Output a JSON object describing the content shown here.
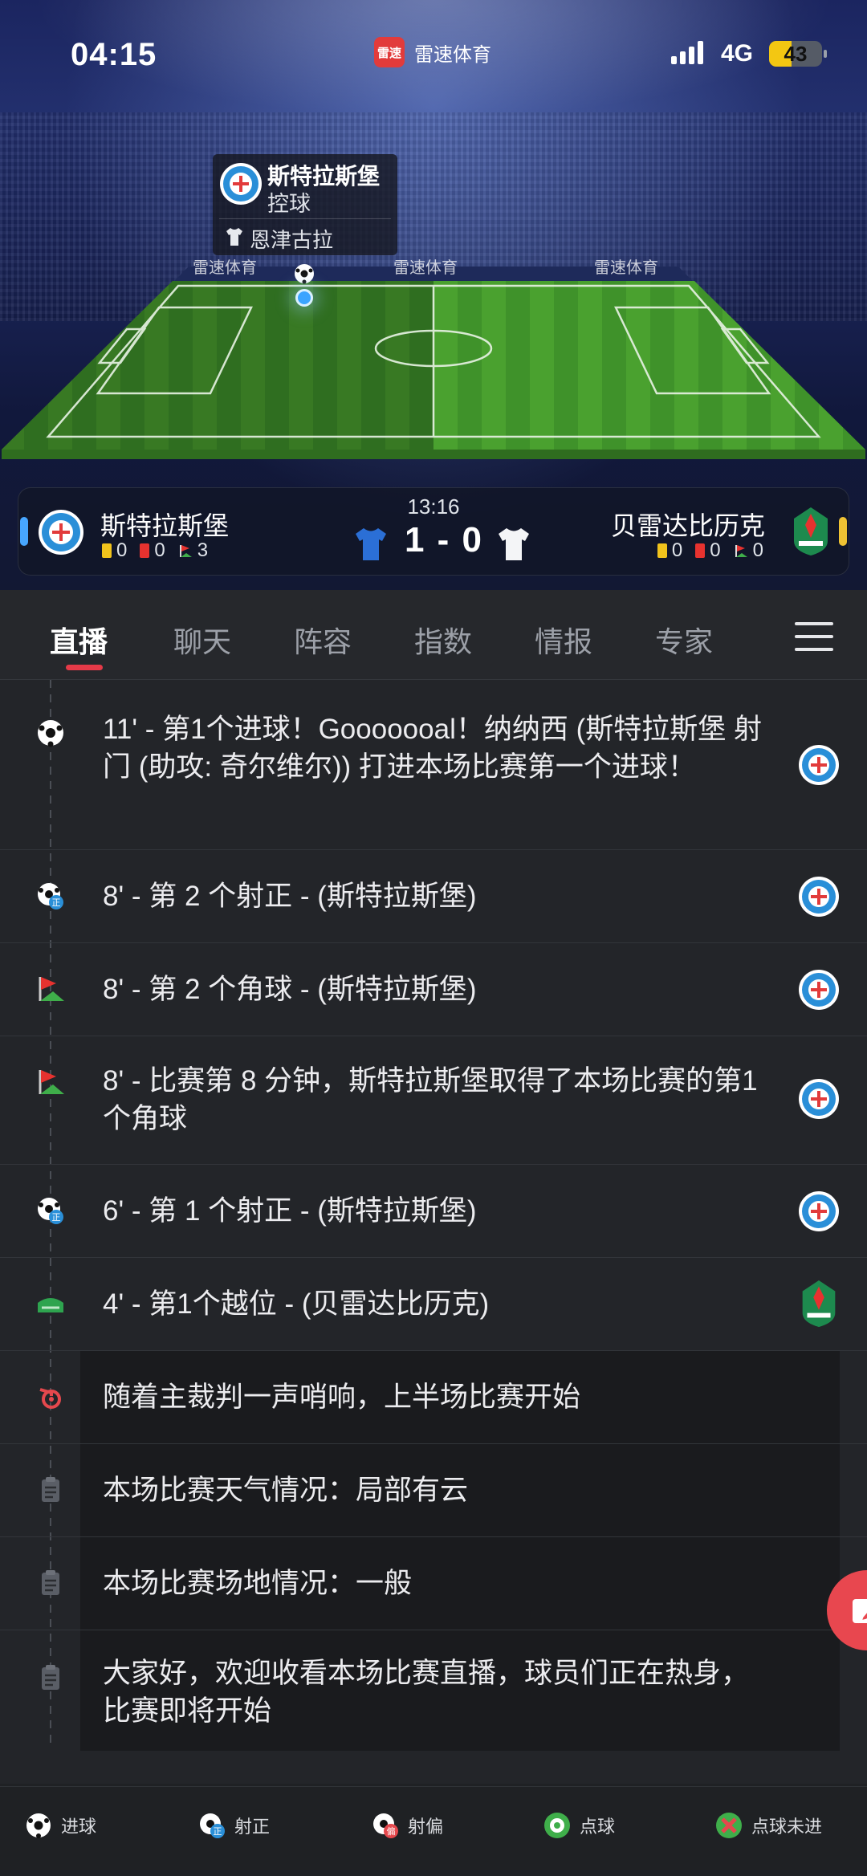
{
  "status_bar": {
    "time": "04:15",
    "app_name": "雷速体育",
    "app_logo_text": "雷速",
    "network": "4G",
    "battery": "43",
    "battery_level": 0.43
  },
  "possession": {
    "team": "斯特拉斯堡",
    "state": "控球",
    "player": "恩津古拉"
  },
  "pitch": {
    "ad_text": "雷速体育"
  },
  "scoreboard": {
    "minute": "13:16",
    "score": "1 - 0",
    "home": {
      "name": "斯特拉斯堡",
      "yellow": "0",
      "red": "0",
      "corners": "3",
      "color": "#47a6ff"
    },
    "away": {
      "name": "贝雷达比历克",
      "yellow": "0",
      "red": "0",
      "corners": "0",
      "color": "#f0c333"
    }
  },
  "tabs": [
    "直播",
    "聊天",
    "阵容",
    "指数",
    "情报",
    "专家"
  ],
  "events": [
    {
      "icon": "goal-icon",
      "text": "11' - 第1个进球！Gooooooal！纳纳西 (斯特拉斯堡 射门 (助攻: 奇尔维尔)) 打进本场比赛第一个进球！",
      "team": "home"
    },
    {
      "icon": "shot-on-target-icon",
      "text": "8' - 第 2 个射正 - (斯特拉斯堡)",
      "team": "home"
    },
    {
      "icon": "corner-flag-icon",
      "text": "8' - 第 2 个角球 - (斯特拉斯堡)",
      "team": "home"
    },
    {
      "icon": "corner-flag-icon",
      "text": "8' - 比赛第 8 分钟，斯特拉斯堡取得了本场比赛的第1个角球",
      "team": "home"
    },
    {
      "icon": "shot-on-target-icon",
      "text": "6' - 第 1 个射正 - (斯特拉斯堡)",
      "team": "home"
    },
    {
      "icon": "offside-icon",
      "text": "4' - 第1个越位 - (贝雷达比历克)",
      "team": "away"
    },
    {
      "icon": "whistle-icon",
      "text": "随着主裁判一声哨响，上半场比赛开始",
      "team": ""
    },
    {
      "icon": "clipboard-icon",
      "text": "本场比赛天气情况：局部有云",
      "team": ""
    },
    {
      "icon": "clipboard-icon",
      "text": "本场比赛场地情况：一般",
      "team": ""
    },
    {
      "icon": "clipboard-icon",
      "text": "大家好，欢迎收看本场比赛直播，球员们正在热身，比赛即将开始",
      "team": ""
    }
  ],
  "legend": [
    "进球",
    "射正",
    "射偏",
    "点球",
    "点球未进"
  ]
}
